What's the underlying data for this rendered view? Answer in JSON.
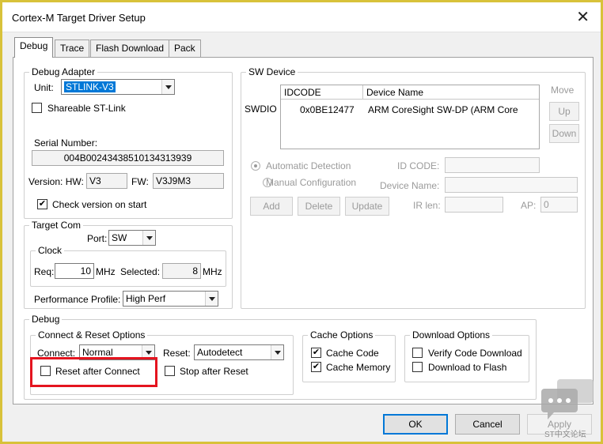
{
  "window": {
    "title": "Cortex-M Target Driver Setup"
  },
  "tabs": [
    {
      "label": "Debug",
      "active": true
    },
    {
      "label": "Trace",
      "active": false
    },
    {
      "label": "Flash Download",
      "active": false
    },
    {
      "label": "Pack",
      "active": false
    }
  ],
  "debug_adapter": {
    "legend": "Debug Adapter",
    "unit_label": "Unit:",
    "unit_value": "STLINK-V3",
    "shareable_label": "Shareable ST-Link",
    "shareable_checked": false,
    "serial_label": "Serial Number:",
    "serial_value": "004B00243438510134313939",
    "version_label": "Version: HW:",
    "hw_value": "V3",
    "fw_label": "FW:",
    "fw_value": "V3J9M3",
    "check_version_label": "Check version on start",
    "check_version_checked": true,
    "check_mark": "✔"
  },
  "target_com": {
    "legend": "Target Com",
    "port_label": "Port:",
    "port_value": "SW",
    "clock_legend": "Clock",
    "req_label": "Req:",
    "req_value": "10",
    "req_unit": "MHz",
    "selected_label": "Selected:",
    "selected_value": "8",
    "selected_unit": "MHz",
    "profile_label": "Performance Profile:",
    "profile_value": "High Perf"
  },
  "sw_device": {
    "legend": "SW Device",
    "swdio_label": "SWDIO",
    "columns": [
      "IDCODE",
      "Device Name"
    ],
    "rows": [
      {
        "idcode": "0x0BE12477",
        "device_name": "ARM CoreSight SW-DP (ARM Core"
      }
    ],
    "move_label": "Move",
    "up_label": "Up",
    "down_label": "Down",
    "auto_detect_label": "Automatic Detection",
    "manual_config_label": "Manual Configuration",
    "id_code_label": "ID CODE:",
    "device_name_label": "Device Name:",
    "add_label": "Add",
    "delete_label": "Delete",
    "update_label": "Update",
    "ir_len_label": "IR len:",
    "ap_label": "AP:",
    "ap_value": "0"
  },
  "debug": {
    "legend": "Debug",
    "connect_reset": {
      "legend": "Connect & Reset Options",
      "connect_label": "Connect:",
      "connect_value": "Normal",
      "reset_label": "Reset:",
      "reset_value": "Autodetect",
      "reset_after_connect_label": "Reset after Connect",
      "reset_after_connect_checked": false,
      "stop_after_reset_label": "Stop after Reset",
      "stop_after_reset_checked": false
    },
    "cache": {
      "legend": "Cache Options",
      "cache_code_label": "Cache Code",
      "cache_code_checked": true,
      "cache_memory_label": "Cache Memory",
      "cache_memory_checked": true
    },
    "download": {
      "legend": "Download Options",
      "verify_label": "Verify Code Download",
      "verify_checked": false,
      "flash_label": "Download to Flash",
      "flash_checked": false
    }
  },
  "footer": {
    "ok_label": "OK",
    "cancel_label": "Cancel",
    "apply_label": "Apply"
  },
  "watermark": {
    "text": "ST中文论坛"
  },
  "colors": {
    "highlight": "#e4141f",
    "frame": "#d8c23a",
    "selection": "#0078d7"
  },
  "icons": {
    "close": "close-icon",
    "dropdown": "chevron-down-icon",
    "check": "checkmark-icon",
    "chat": "chat-bubble-icon"
  }
}
